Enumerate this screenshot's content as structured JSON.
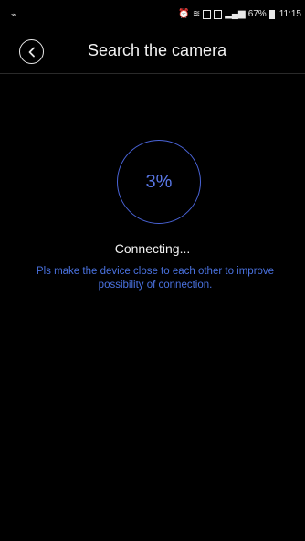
{
  "status_bar": {
    "left_icon": "cast-icon",
    "battery_percent": "67%",
    "time": "11:15"
  },
  "header": {
    "back_icon": "chevron-left-icon",
    "title": "Search the camera"
  },
  "progress": {
    "percent_text": "3%",
    "value_fraction": 0.03
  },
  "status_text": "Connecting...",
  "hint": "Pls make the device close to each other to improve possibility of connection.",
  "colors": {
    "background": "#000000",
    "accent": "#4a64d8",
    "hint": "#4a72e0"
  }
}
